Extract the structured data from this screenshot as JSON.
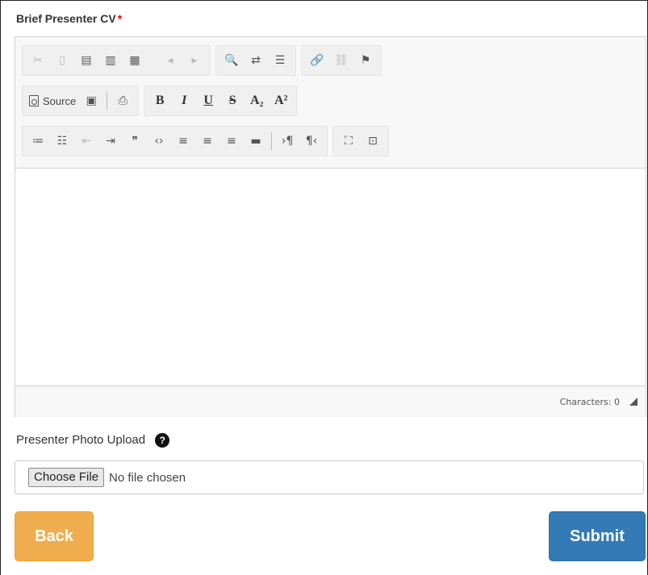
{
  "cv_field": {
    "label": "Brief Presenter CV",
    "required_mark": "*"
  },
  "toolbar": {
    "row1": [
      {
        "name": "cut-icon",
        "glyph": "✂",
        "enabled": false
      },
      {
        "name": "copy-icon",
        "glyph": "▯",
        "enabled": false
      },
      {
        "name": "paste-icon",
        "glyph": "▤",
        "enabled": true
      },
      {
        "name": "paste-text-icon",
        "glyph": "▥",
        "enabled": true
      },
      {
        "name": "paste-word-icon",
        "glyph": "▦",
        "enabled": true
      },
      {
        "name": "undo-icon",
        "glyph": "◂",
        "enabled": false
      },
      {
        "name": "redo-icon",
        "glyph": "▸",
        "enabled": false
      },
      {
        "name": "find-icon",
        "glyph": "🔍",
        "enabled": true
      },
      {
        "name": "replace-icon",
        "glyph": "⇄",
        "enabled": true
      },
      {
        "name": "select-all-icon",
        "glyph": "☰",
        "enabled": true
      },
      {
        "name": "link-icon",
        "glyph": "🔗",
        "enabled": true
      },
      {
        "name": "unlink-icon",
        "glyph": "⛓",
        "enabled": false
      },
      {
        "name": "anchor-icon",
        "glyph": "⚑",
        "enabled": true
      }
    ],
    "source_label": "Source",
    "row2": [
      {
        "name": "bold-button",
        "glyph": "B"
      },
      {
        "name": "italic-button",
        "glyph": "I"
      },
      {
        "name": "underline-button",
        "glyph": "U"
      },
      {
        "name": "strike-button",
        "glyph": "S"
      },
      {
        "name": "subscript-button",
        "glyph": "A₂"
      },
      {
        "name": "superscript-button",
        "glyph": "A²"
      }
    ],
    "row3": [
      {
        "name": "numbered-list-icon",
        "glyph": "≔",
        "enabled": true
      },
      {
        "name": "bulleted-list-icon",
        "glyph": "☷",
        "enabled": true
      },
      {
        "name": "outdent-icon",
        "glyph": "⇤",
        "enabled": false
      },
      {
        "name": "indent-icon",
        "glyph": "⇥",
        "enabled": true
      },
      {
        "name": "blockquote-icon",
        "glyph": "❞",
        "enabled": true
      },
      {
        "name": "code-icon",
        "glyph": "‹›",
        "enabled": true
      },
      {
        "name": "align-left-icon",
        "glyph": "≡",
        "enabled": true
      },
      {
        "name": "align-center-icon",
        "glyph": "≡",
        "enabled": true
      },
      {
        "name": "align-right-icon",
        "glyph": "≡",
        "enabled": true
      },
      {
        "name": "justify-icon",
        "glyph": "▬",
        "enabled": true
      },
      {
        "name": "ltr-icon",
        "glyph": "›¶",
        "enabled": true
      },
      {
        "name": "rtl-icon",
        "glyph": "¶‹",
        "enabled": true
      },
      {
        "name": "maximize-icon",
        "glyph": "⛶",
        "enabled": true
      },
      {
        "name": "show-blocks-icon",
        "glyph": "⊡",
        "enabled": true
      }
    ]
  },
  "status": {
    "characters": "Characters: 0"
  },
  "photo_field": {
    "label": "Presenter Photo Upload",
    "help_glyph": "?",
    "choose_label": "Choose File",
    "file_status": "No file chosen"
  },
  "actions": {
    "back_label": "Back",
    "submit_label": "Submit"
  },
  "colors": {
    "back": "#f0ad4e",
    "submit": "#337ab7",
    "required": "#e00000"
  }
}
